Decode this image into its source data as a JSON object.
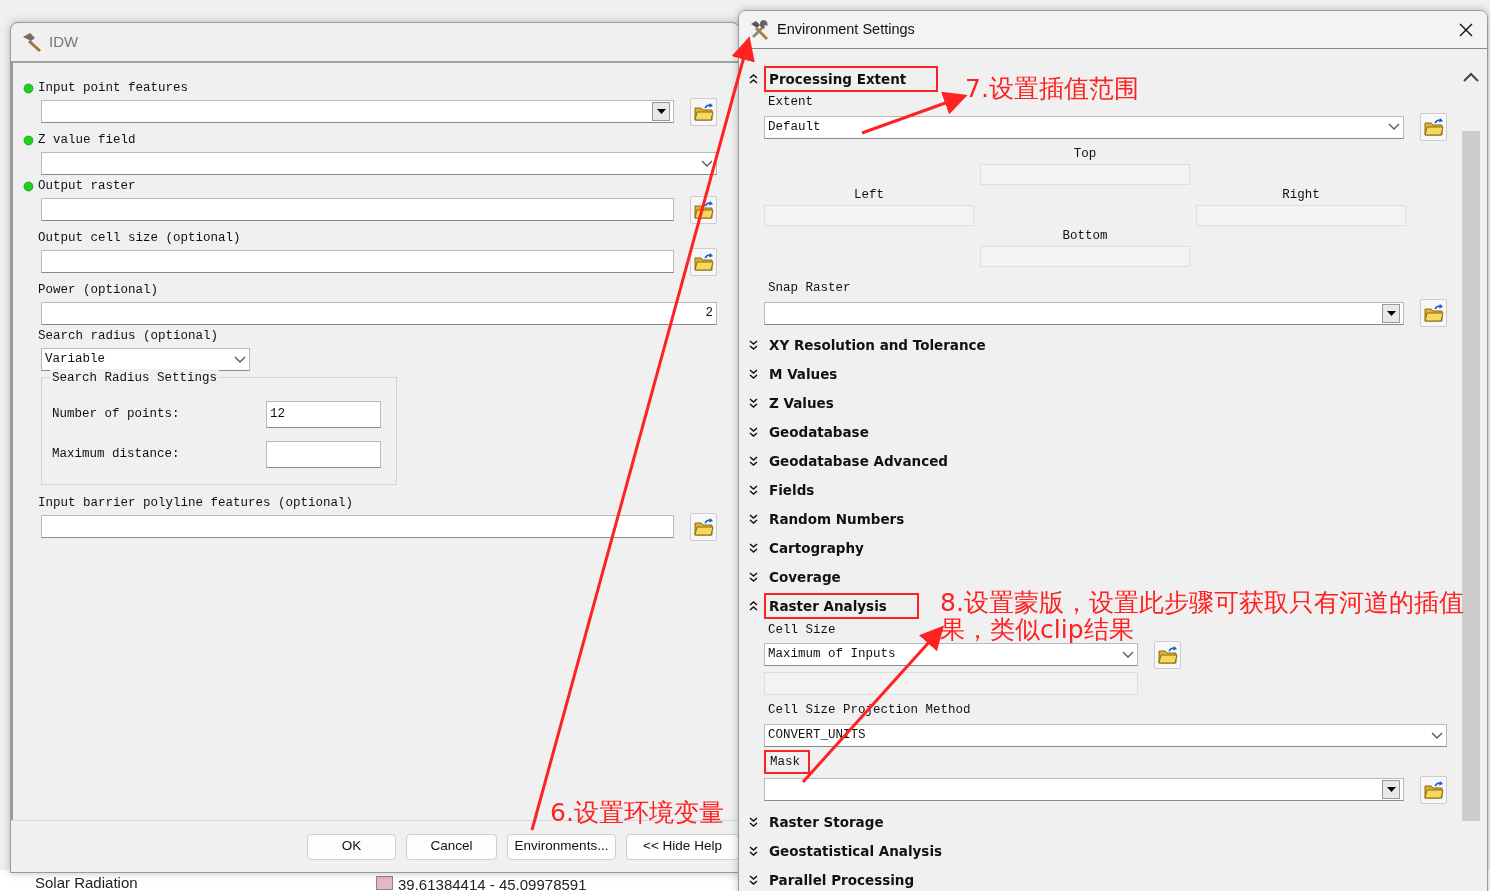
{
  "background": {
    "layer_name": "Solar Radiation",
    "legend_range": "39.61384414 - 45.09978591"
  },
  "idw_dialog": {
    "title": "IDW",
    "params": [
      {
        "label": "Input point features",
        "required": true,
        "kind": "combo",
        "browse": true
      },
      {
        "label": "Z value field",
        "required": true,
        "kind": "select"
      },
      {
        "label": "Output raster",
        "required": true,
        "kind": "text",
        "browse": true
      },
      {
        "label": "Output cell size (optional)",
        "required": false,
        "kind": "text",
        "browse": true
      },
      {
        "label": "Power (optional)",
        "required": false,
        "kind": "number",
        "value": "2"
      },
      {
        "label": "Search radius (optional)",
        "required": false,
        "kind": "short-select",
        "value": "Variable"
      },
      {
        "kind": "group",
        "label": "Search Radius Settings",
        "fields": [
          {
            "label": "Number of points:",
            "value": "12"
          },
          {
            "label": "Maximum distance:"
          }
        ]
      },
      {
        "label": "Input barrier polyline features (optional)",
        "required": false,
        "kind": "text",
        "browse": true
      }
    ],
    "buttons": [
      "OK",
      "Cancel",
      "Environments...",
      "<< Hide Help"
    ]
  },
  "environment_dialog": {
    "title": "Environment Settings",
    "sections": [
      {
        "title": "Processing Extent",
        "expanded": true,
        "highlighted": true,
        "fields": [
          {
            "kind": "select",
            "label": "Extent",
            "value": "Default",
            "browse": true
          },
          {
            "kind": "extent",
            "top": "Top",
            "left": "Left",
            "right": "Right",
            "bottom": "Bottom"
          },
          {
            "kind": "combo",
            "label": "Snap Raster",
            "browse": true
          }
        ]
      },
      {
        "title": "XY Resolution and Tolerance",
        "expanded": false,
        "highlighted": false
      },
      {
        "title": "M Values",
        "expanded": false,
        "highlighted": false
      },
      {
        "title": "Z Values",
        "expanded": false,
        "highlighted": false
      },
      {
        "title": "Geodatabase",
        "expanded": false,
        "highlighted": false
      },
      {
        "title": "Geodatabase Advanced",
        "expanded": false,
        "highlighted": false
      },
      {
        "title": "Fields",
        "expanded": false,
        "highlighted": false
      },
      {
        "title": "Random Numbers",
        "expanded": false,
        "highlighted": false
      },
      {
        "title": "Cartography",
        "expanded": false,
        "highlighted": false
      },
      {
        "title": "Coverage",
        "expanded": false,
        "highlighted": false
      },
      {
        "title": "Raster Analysis",
        "expanded": true,
        "highlighted": true,
        "fields": [
          {
            "kind": "short-select",
            "label": "Cell Size",
            "value": "Maximum of Inputs",
            "browse": true
          },
          {
            "kind": "disabled-field"
          },
          {
            "kind": "select",
            "label": "Cell Size Projection Method",
            "value": "CONVERT_UNITS"
          },
          {
            "kind": "combo",
            "label": "Mask",
            "highlighted": true,
            "browse": true
          }
        ]
      },
      {
        "title": "Raster Storage",
        "expanded": false,
        "highlighted": false
      },
      {
        "title": "Geostatistical Analysis",
        "expanded": false,
        "highlighted": false
      },
      {
        "title": "Parallel Processing",
        "expanded": false,
        "highlighted": false
      }
    ]
  },
  "callouts": [
    {
      "lines": [
        "6.设置环境变量"
      ]
    },
    {
      "lines": [
        "7.设置插值范围"
      ]
    },
    {
      "lines": [
        "8.设置蒙版，设置此步骤可获取只有河道的插值",
        "果，类似clip结果"
      ]
    }
  ]
}
